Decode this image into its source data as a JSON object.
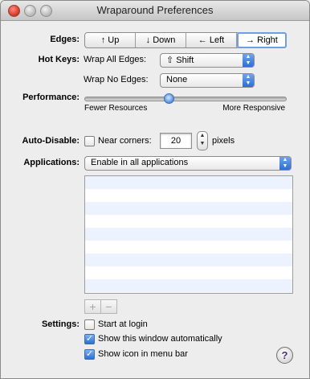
{
  "window": {
    "title": "Wraparound Preferences"
  },
  "edges": {
    "label": "Edges:",
    "segments": [
      "↑ Up",
      "↓ Down",
      "← Left",
      "→ Right"
    ],
    "selected": "→ Right"
  },
  "hotkeys": {
    "label": "Hot Keys:",
    "wrap_all_label": "Wrap All Edges:",
    "wrap_all_value": "⇧ Shift",
    "wrap_none_label": "Wrap No Edges:",
    "wrap_none_value": "None"
  },
  "performance": {
    "label": "Performance:",
    "min_label": "Fewer Resources",
    "max_label": "More Responsive",
    "value_fraction": 0.42
  },
  "auto_disable": {
    "label": "Auto-Disable:",
    "near_corners_label": "Near corners:",
    "near_corners_checked": false,
    "pixels_value": "20",
    "unit": "pixels"
  },
  "applications": {
    "label": "Applications:",
    "mode_value": "Enable in all applications",
    "list_items": [],
    "add_label": "+",
    "remove_label": "−"
  },
  "settings": {
    "label": "Settings:",
    "start_at_login": "Start at login",
    "start_at_login_checked": false,
    "show_window": "Show this window automatically",
    "show_window_checked": true,
    "show_icon": "Show icon in menu bar",
    "show_icon_checked": true
  },
  "help": {
    "label": "?"
  },
  "colors": {
    "accent": "#2c6fd6",
    "selected_outline": "#6e9ee4",
    "list_stripe": "#edf3fe"
  },
  "icons": {
    "close": "close-icon",
    "minimize": "minimize-icon",
    "zoom": "zoom-icon",
    "help": "help-icon"
  }
}
